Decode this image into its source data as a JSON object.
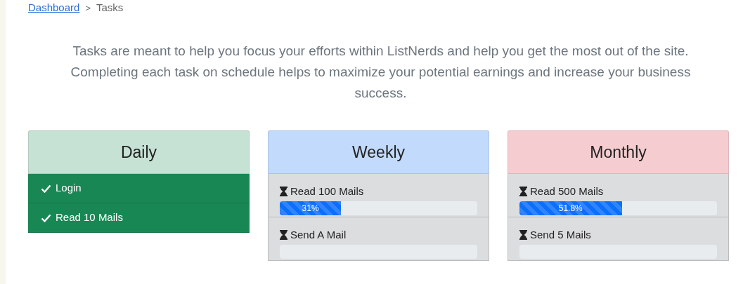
{
  "breadcrumb": {
    "link": "Dashboard",
    "separator": ">",
    "current": "Tasks"
  },
  "intro": "Tasks are meant to help you focus your efforts within ListNerds and help you get the most out of the site. Completing each task on schedule helps to maximize your potential earnings and increase your business success.",
  "cards": [
    {
      "title": "Daily",
      "color": "#c6e2d4",
      "tasks": [
        {
          "label": "Login",
          "completed": true
        },
        {
          "label": "Read 10 Mails",
          "completed": true
        }
      ]
    },
    {
      "title": "Weekly",
      "color": "#c2dafb",
      "tasks": [
        {
          "label": "Read 100 Mails",
          "completed": false,
          "level": 0.31,
          "reading": "31%"
        },
        {
          "label": "Send A Mail",
          "completed": false
        }
      ]
    },
    {
      "title": "Monthly",
      "color": "#f5cdd1",
      "tasks": [
        {
          "label": "Read 500 Mails",
          "completed": false,
          "level": 0.518,
          "reading": "51.8%"
        },
        {
          "label": "Send 5 Mails",
          "completed": false
        }
      ]
    }
  ]
}
